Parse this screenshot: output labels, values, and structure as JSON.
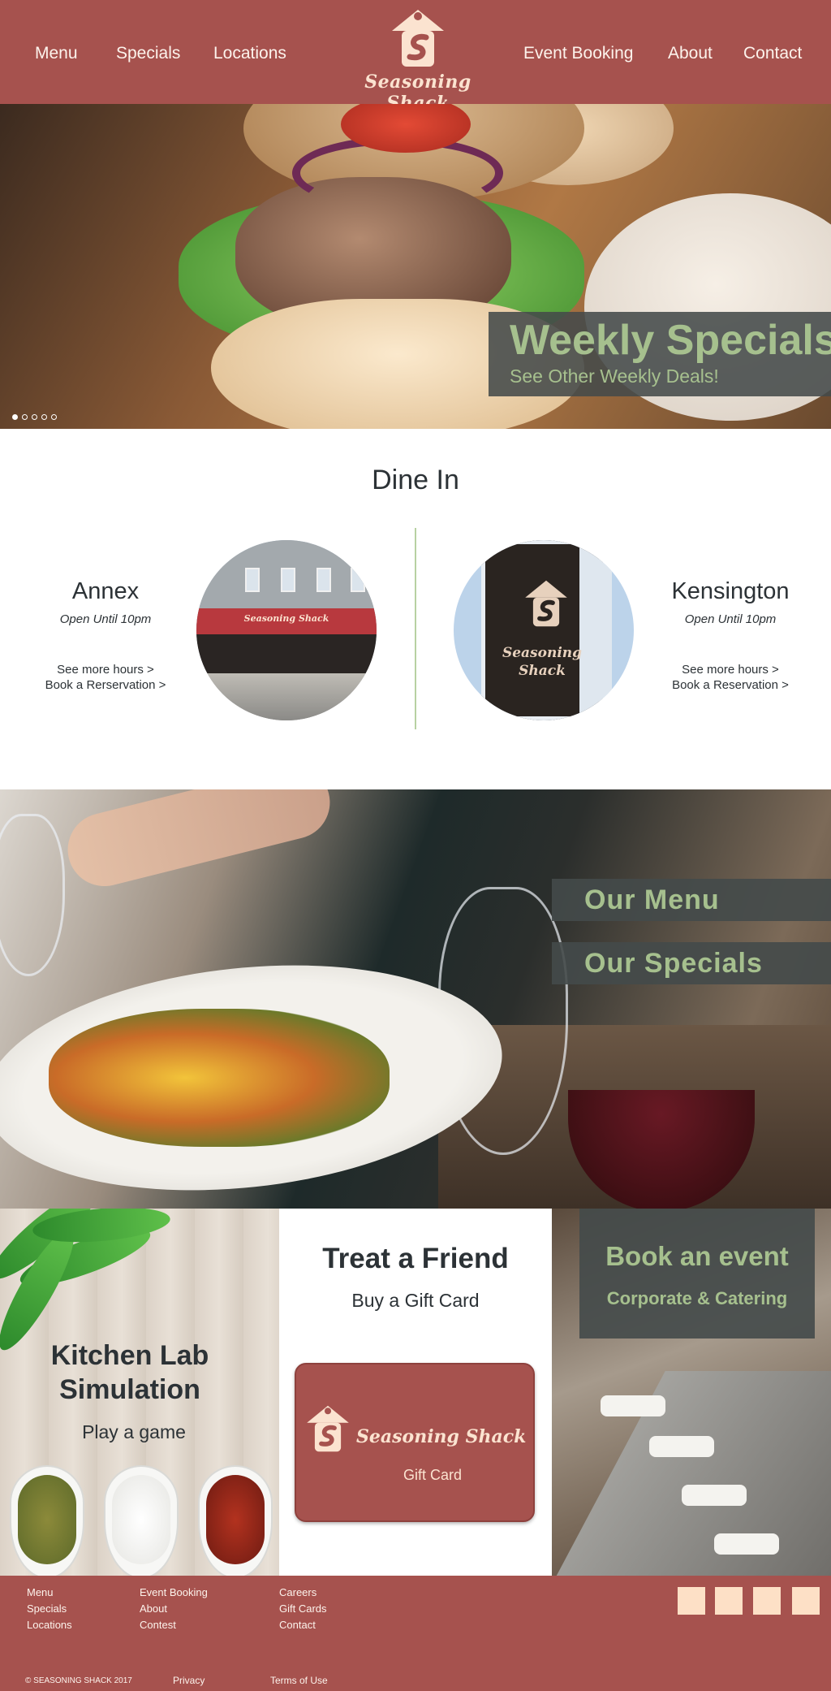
{
  "header": {
    "nav_left": [
      "Menu",
      "Specials",
      "Locations"
    ],
    "nav_right": [
      "Event Booking",
      "About",
      "Contact"
    ],
    "logo_text": "Seasoning Shack"
  },
  "hero": {
    "title": "Weekly Specials",
    "subtitle": "See Other Weekly Deals!",
    "slides": 5,
    "active_slide": 1
  },
  "dine_in": {
    "title": "Dine In",
    "locations": [
      {
        "name": "Annex",
        "hours": "Open Until 10pm",
        "link1": "See more hours >",
        "link2": "Book a Rerservation >",
        "sign": "Seasoning Shack"
      },
      {
        "name": "Kensington",
        "hours": "Open Until 10pm",
        "link1": "See more hours >",
        "link2": "Book a Reservation >",
        "sign_line1": "Seasoning",
        "sign_line2": "Shack"
      }
    ]
  },
  "menu_section": {
    "buttons": [
      "Our Menu",
      "Our Specials"
    ]
  },
  "kitchen_lab": {
    "title_line1": "Kitchen Lab",
    "title_line2": "Simulation",
    "subtitle": "Play a game"
  },
  "gift": {
    "title": "Treat a Friend",
    "subtitle": "Buy a Gift Card",
    "card_name": "Seasoning Shack",
    "card_label": "Gift Card"
  },
  "event": {
    "title": "Book an event",
    "subtitle": "Corporate & Catering"
  },
  "footer": {
    "col1": [
      "Menu",
      "Specials",
      "Locations"
    ],
    "col2": [
      "Event Booking",
      "About",
      "Contest"
    ],
    "col3": [
      "Careers",
      "Gift Cards",
      "Contact"
    ],
    "copyright": "© SEASONING SHACK 2017",
    "privacy": "Privacy",
    "terms": "Terms of Use",
    "social_icons": [
      "social-icon-1",
      "social-icon-2",
      "social-icon-3",
      "social-icon-4"
    ]
  },
  "colors": {
    "brand": "#a6524e",
    "accent_green": "#a6c08e",
    "overlay": "#444a4a",
    "cream": "#fde0c6"
  }
}
